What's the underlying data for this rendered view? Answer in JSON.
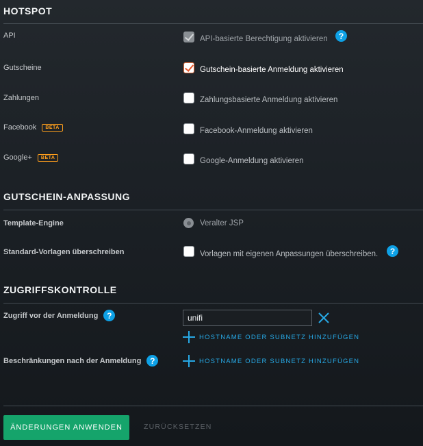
{
  "hotspot": {
    "title": "HOTSPOT",
    "api": {
      "label": "API",
      "option": "API-basierte Berechtigung aktivieren",
      "checked": true,
      "disabled": true
    },
    "vouchers": {
      "label": "Gutscheine",
      "option": "Gutschein-basierte Anmeldung aktivieren",
      "checked": true
    },
    "payments": {
      "label": "Zahlungen",
      "option": "Zahlungsbasierte Anmeldung aktivieren",
      "checked": false
    },
    "facebook": {
      "label": "Facebook",
      "badge": "BETA",
      "option": "Facebook-Anmeldung aktivieren",
      "checked": false
    },
    "google": {
      "label": "Google+",
      "badge": "BETA",
      "option": "Google-Anmeldung aktivieren",
      "checked": false
    }
  },
  "voucher_customization": {
    "title": "GUTSCHEIN-ANPASSUNG",
    "template_engine": {
      "label": "Template-Engine",
      "option": "Veralter JSP"
    },
    "override_templates": {
      "label": "Standard-Vorlagen überschreiben",
      "option": "Vorlagen mit eigenen Anpassungen überschreiben.",
      "checked": false
    }
  },
  "access_control": {
    "title": "ZUGRIFFSKONTROLLE",
    "pre_auth": {
      "label": "Zugriff vor der Anmeldung",
      "value": "unifi",
      "add_label": "HOSTNAME ODER SUBNETZ HINZUFÜGEN"
    },
    "post_auth": {
      "label": "Beschränkungen nach der Anmeldung",
      "add_label": "HOSTNAME ODER SUBNETZ HINZUFÜGEN"
    }
  },
  "help_glyph": "?",
  "footer": {
    "apply_label": "ÄNDERUNGEN ANWENDEN",
    "reset_label": "ZURÜCKSETZEN"
  },
  "colors": {
    "accent": "#0ea1e6",
    "primary_button": "#15a46b",
    "beta": "#ff9f1c",
    "checked": "#e8572a"
  }
}
